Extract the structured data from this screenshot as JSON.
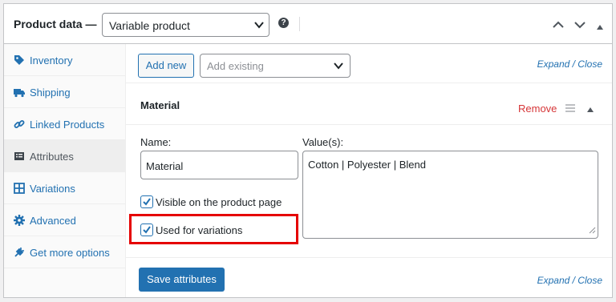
{
  "header": {
    "title": "Product data —",
    "product_type": "Variable product",
    "help_glyph": "?"
  },
  "sidebar": {
    "items": [
      {
        "label": "Inventory",
        "icon": "tag-icon"
      },
      {
        "label": "Shipping",
        "icon": "truck-icon"
      },
      {
        "label": "Linked Products",
        "icon": "link-icon"
      },
      {
        "label": "Attributes",
        "icon": "list-icon",
        "active": true
      },
      {
        "label": "Variations",
        "icon": "grid-icon"
      },
      {
        "label": "Advanced",
        "icon": "gear-icon"
      },
      {
        "label": "Get more options",
        "icon": "plugin-icon"
      }
    ]
  },
  "toolbar": {
    "add_new": "Add new",
    "add_existing_placeholder": "Add existing",
    "expand_close": "Expand / Close"
  },
  "attribute": {
    "name": "Material",
    "remove": "Remove",
    "name_label": "Name:",
    "name_value": "Material",
    "values_label": "Value(s):",
    "values_value": "Cotton | Polyester | Blend",
    "visible_label": "Visible on the product page",
    "visible_checked": true,
    "variations_label": "Used for variations",
    "variations_checked": true
  },
  "footer": {
    "save": "Save attributes",
    "expand_close": "Expand / Close"
  },
  "colors": {
    "accent": "#2271b1",
    "remove": "#d63638",
    "highlight": "#e50000"
  }
}
